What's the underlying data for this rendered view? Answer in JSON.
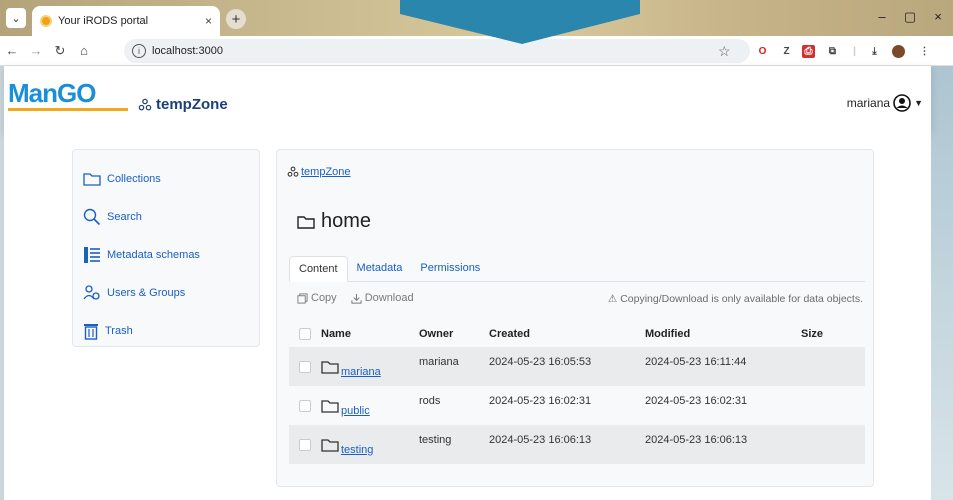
{
  "browser": {
    "tab_title": "Your iRODS portal",
    "tab_close": "×",
    "new_tab": "+",
    "url": "localhost:3000",
    "window_buttons": [
      "–",
      "▢",
      "×"
    ]
  },
  "header": {
    "logo_text": "ManGO",
    "zone_name": "tempZone",
    "user_name": "mariana"
  },
  "sidebar": {
    "items": [
      {
        "label": "Collections",
        "icon": "folder-icon"
      },
      {
        "label": "Search",
        "icon": "search-icon"
      },
      {
        "label": "Metadata schemas",
        "icon": "list-icon"
      },
      {
        "label": "Users & Groups",
        "icon": "users-icon"
      },
      {
        "label": "Trash",
        "icon": "trash-icon"
      }
    ]
  },
  "main": {
    "breadcrumb": "tempZone",
    "title": "home",
    "tabs": [
      {
        "label": "Content",
        "active": true
      },
      {
        "label": "Metadata",
        "active": false
      },
      {
        "label": "Permissions",
        "active": false
      }
    ],
    "copy_label": "Copy",
    "download_label": "Download",
    "notice": "⚠ Copying/Download is only available for data objects.",
    "table": {
      "headers": {
        "name": "Name",
        "owner": "Owner",
        "created": "Created",
        "modified": "Modified",
        "size": "Size"
      },
      "rows": [
        {
          "name": "mariana",
          "owner": "mariana",
          "created": "2024-05-23 16:05:53",
          "modified": "2024-05-23 16:11:44",
          "size": ""
        },
        {
          "name": "public",
          "owner": "rods",
          "created": "2024-05-23 16:02:31",
          "modified": "2024-05-23 16:02:31",
          "size": ""
        },
        {
          "name": "testing",
          "owner": "testing",
          "created": "2024-05-23 16:06:13",
          "modified": "2024-05-23 16:06:13",
          "size": ""
        }
      ]
    }
  },
  "colors": {
    "link": "#1a5fc2",
    "logo_blue": "#1a8fd8",
    "logo_orange": "#f2a81d",
    "zone_text": "#1c3f7a",
    "deco_arrow": "#2b86ad"
  }
}
